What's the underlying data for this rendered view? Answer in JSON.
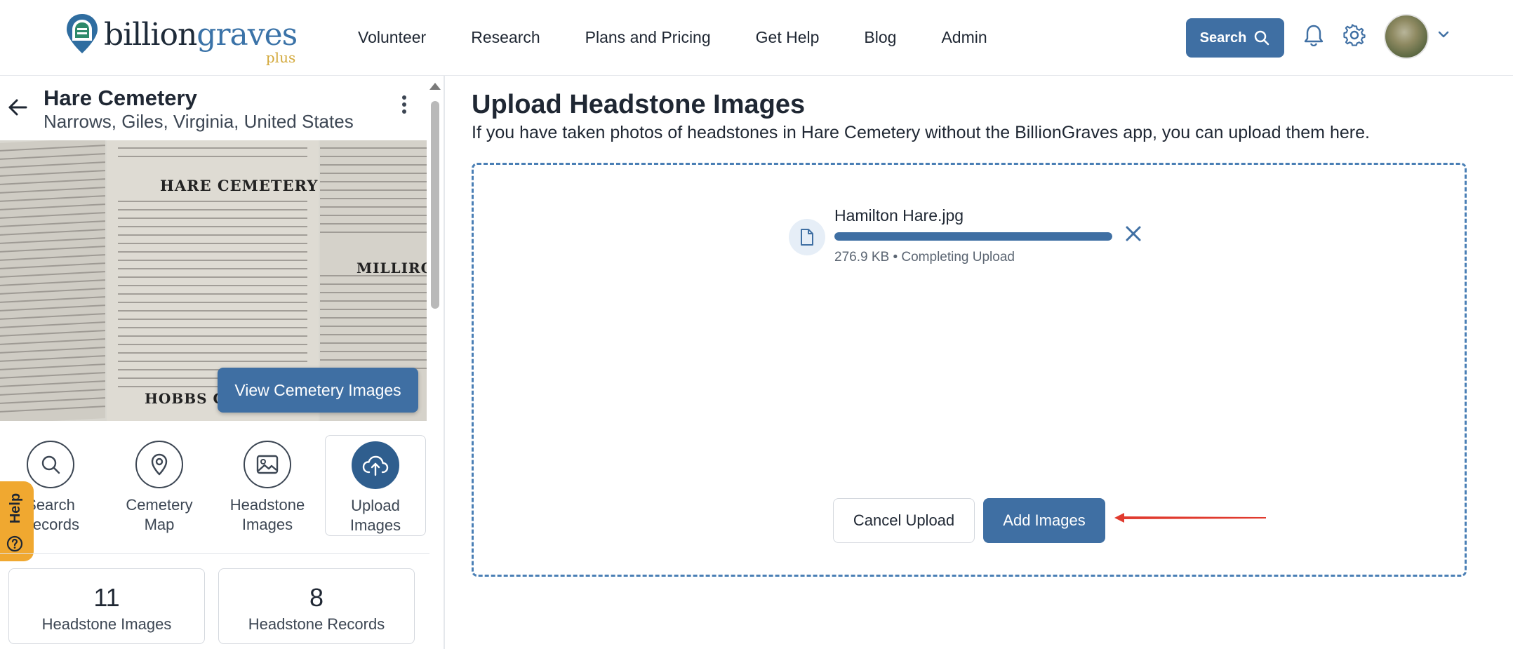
{
  "brand": {
    "name_dark": "billion",
    "name_blue": "graves",
    "tier": "plus",
    "colors": {
      "navy": "#1e2a38",
      "blue": "#3b73a8",
      "gold": "#d3a93c",
      "button": "#3f6fa3"
    }
  },
  "nav": {
    "links": [
      "Volunteer",
      "Research",
      "Plans and Pricing",
      "Get Help",
      "Blog",
      "Admin"
    ],
    "search_label": "Search",
    "icons": [
      "bell-icon",
      "gear-icon",
      "chevron-down-icon"
    ]
  },
  "cemetery": {
    "name": "Hare Cemetery",
    "location": "Narrows, Giles, Virginia, United States",
    "photo_headings": [
      "HARE CEMETERY",
      "MILLIRON",
      "HOBBS CE"
    ],
    "view_images_label": "View Cemetery Images"
  },
  "help_label": "Help",
  "actions": [
    {
      "label_1": "Search",
      "label_2": "Records",
      "icon": "search-icon"
    },
    {
      "label_1": "Cemetery",
      "label_2": "Map",
      "icon": "map-pin-icon"
    },
    {
      "label_1": "Headstone",
      "label_2": "Images",
      "icon": "image-icon"
    },
    {
      "label_1": "Upload",
      "label_2": "Images",
      "icon": "cloud-upload-icon",
      "active": true
    }
  ],
  "stats": [
    {
      "count": "11",
      "label": "Headstone Images"
    },
    {
      "count": "8",
      "label": "Headstone Records"
    }
  ],
  "upload": {
    "title": "Upload Headstone Images",
    "subtitle": "If you have taken photos of headstones in Hare Cemetery without the BillionGraves app, you can upload them here.",
    "file": {
      "name": "Hamilton Hare.jpg",
      "meta": "276.9 KB • Completing Upload",
      "progress": 1.0
    },
    "cancel_label": "Cancel Upload",
    "add_label": "Add Images"
  }
}
